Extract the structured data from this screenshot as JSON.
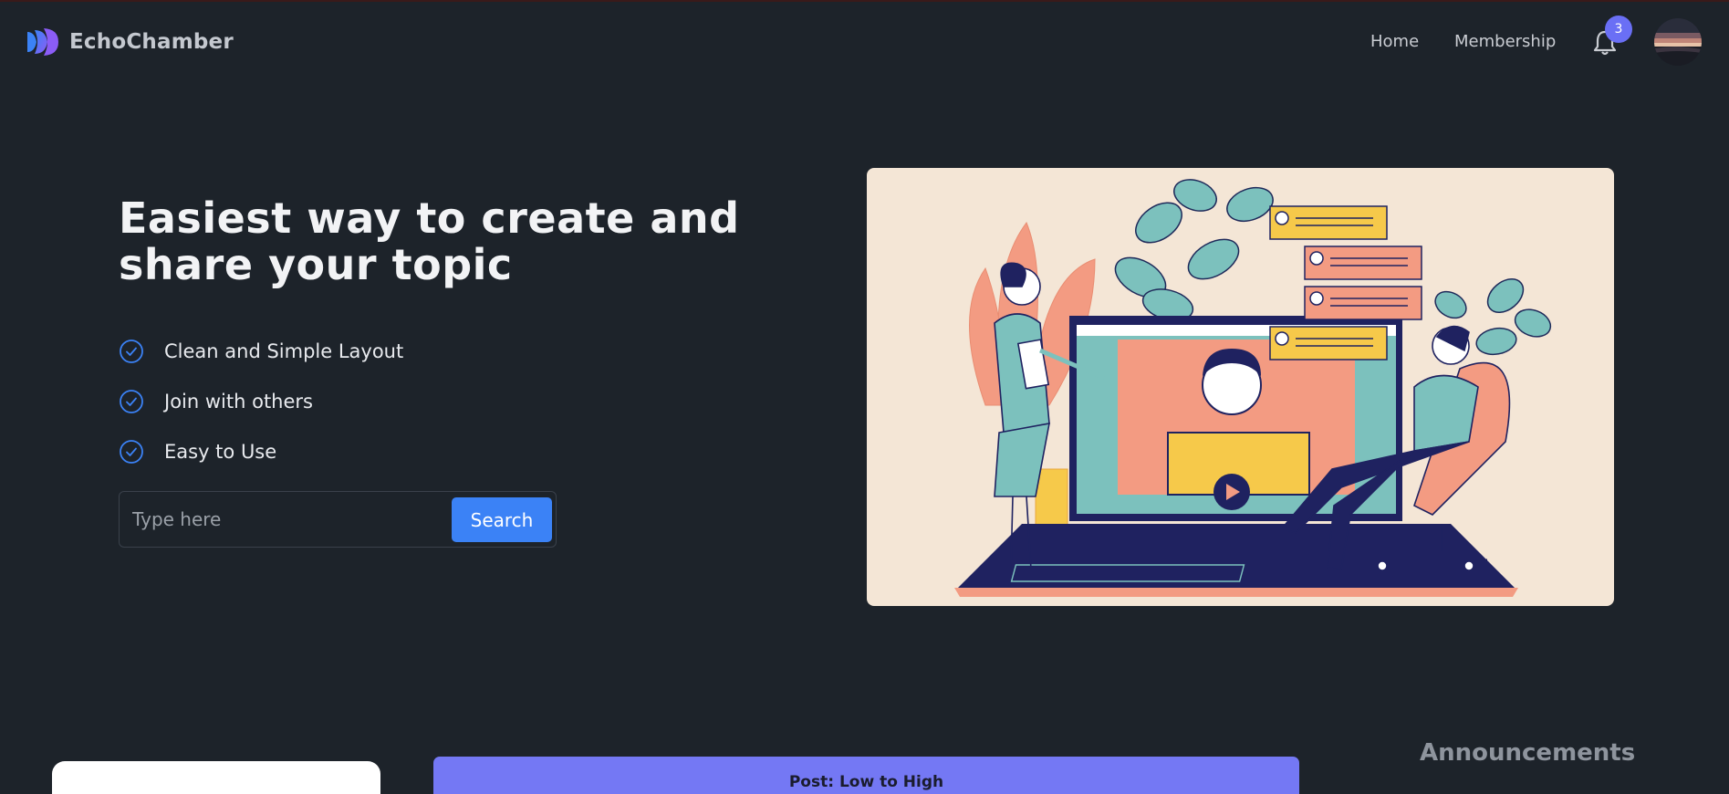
{
  "brand": {
    "name": "EchoChamber"
  },
  "nav": {
    "home": "Home",
    "membership": "Membership",
    "notification_count": "3"
  },
  "hero": {
    "title": "Easiest way to create and share your topic",
    "features": [
      "Clean and Simple Layout",
      "Join with others",
      "Easy to Use"
    ],
    "search": {
      "placeholder": "Type here",
      "button": "Search"
    }
  },
  "posts": {
    "sort_label": "Post: Low to High"
  },
  "sidebar": {
    "announcements_title": "Announcements"
  },
  "colors": {
    "accent": "#3b82f6",
    "badge": "#6a6ff5",
    "sort_bar": "#7478f4",
    "background": "#1d232a"
  }
}
